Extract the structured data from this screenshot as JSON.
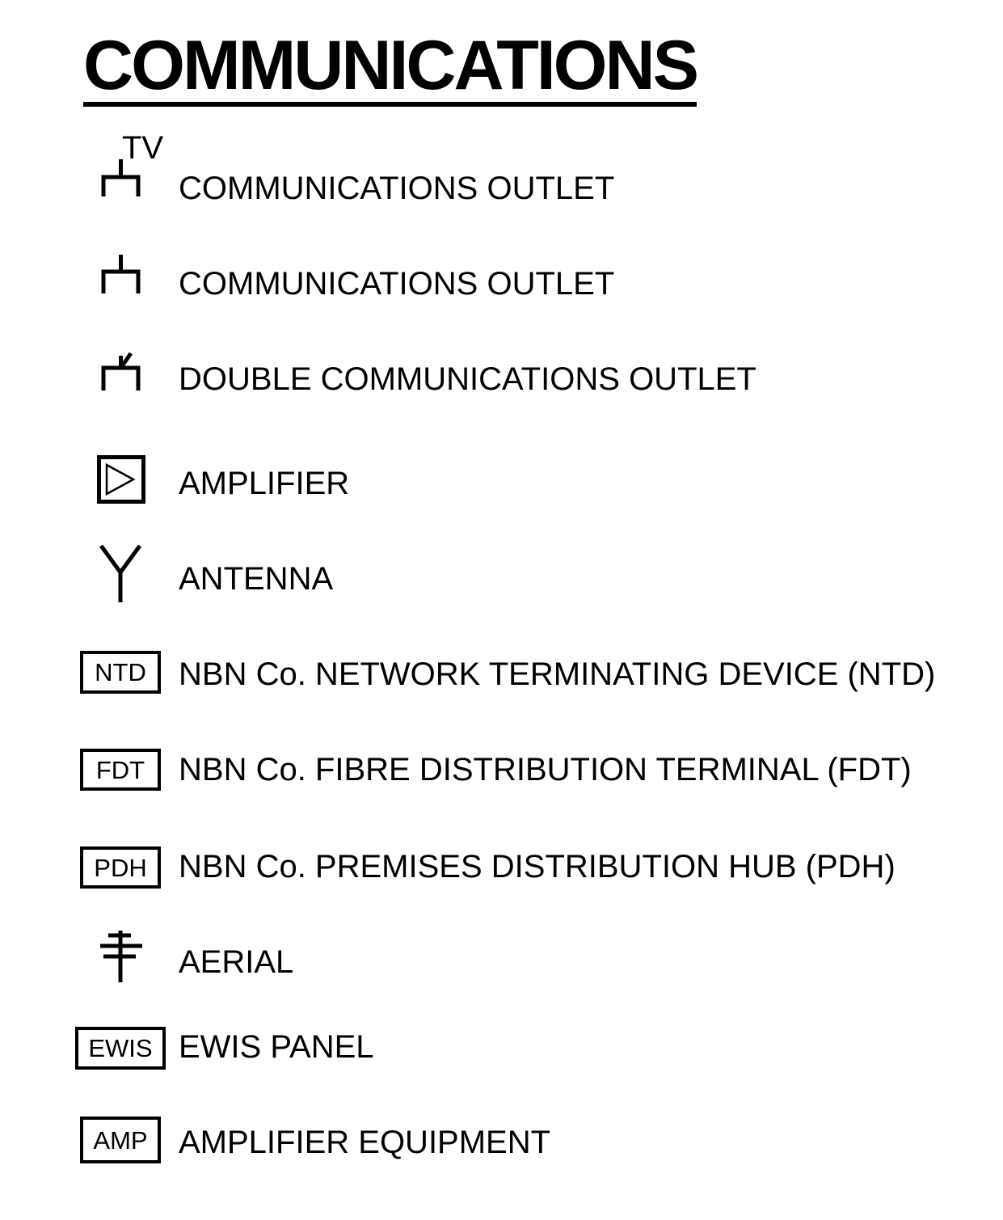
{
  "title": "COMMUNICATIONS",
  "legend": [
    {
      "symbol": "tv-communications-outlet-icon",
      "tag": "TV",
      "label": "COMMUNICATIONS OUTLET"
    },
    {
      "symbol": "communications-outlet-icon",
      "label": "COMMUNICATIONS OUTLET"
    },
    {
      "symbol": "double-communications-outlet-icon",
      "label": "DOUBLE COMMUNICATIONS OUTLET"
    },
    {
      "symbol": "amplifier-icon",
      "label": "AMPLIFIER"
    },
    {
      "symbol": "antenna-icon",
      "label": "ANTENNA"
    },
    {
      "symbol": "ntd-box",
      "tag": "NTD",
      "label": "NBN Co. NETWORK TERMINATING DEVICE (NTD)"
    },
    {
      "symbol": "fdt-box",
      "tag": "FDT",
      "label": "NBN Co. FIBRE DISTRIBUTION TERMINAL (FDT)"
    },
    {
      "symbol": "pdh-box",
      "tag": "PDH",
      "label": "NBN Co. PREMISES DISTRIBUTION HUB (PDH)"
    },
    {
      "symbol": "aerial-icon",
      "label": "AERIAL"
    },
    {
      "symbol": "ewis-box",
      "tag": "EWIS",
      "label": "EWIS PANEL"
    },
    {
      "symbol": "amp-box",
      "tag": "AMP",
      "label": "AMPLIFIER EQUIPMENT"
    }
  ]
}
